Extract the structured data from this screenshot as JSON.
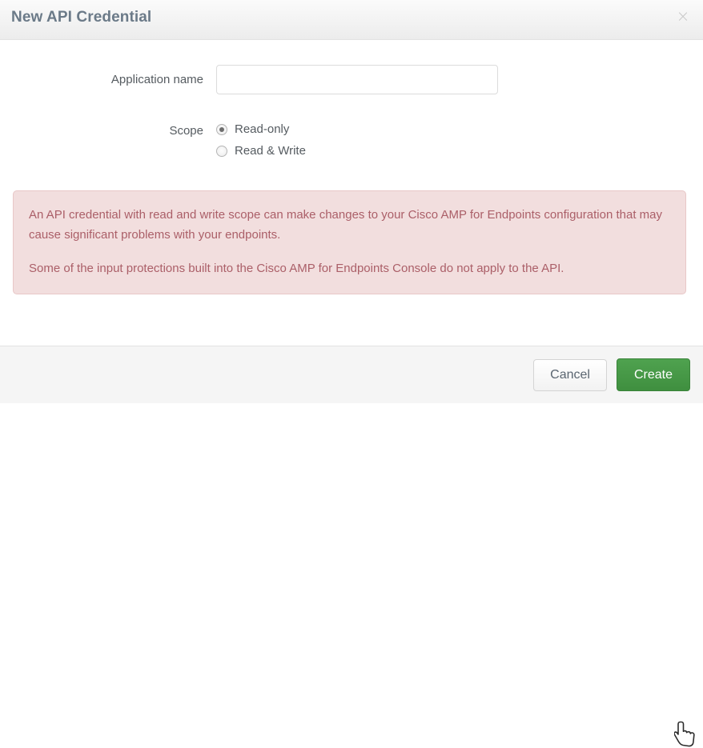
{
  "dialog": {
    "title": "New API Credential",
    "close_icon": "close-icon"
  },
  "form": {
    "application_name": {
      "label": "Application name",
      "value": "",
      "placeholder": ""
    },
    "scope": {
      "label": "Scope",
      "selected": "Read-only",
      "options": [
        {
          "label": "Read-only",
          "checked": true
        },
        {
          "label": "Read & Write",
          "checked": false
        }
      ]
    }
  },
  "warning": {
    "paragraphs": [
      "An API credential with read and write scope can make changes to your Cisco AMP for Endpoints configuration that may cause significant problems with your endpoints.",
      "Some of the input protections built into the Cisco AMP for Endpoints Console do not apply to the API."
    ]
  },
  "footer": {
    "cancel_label": "Cancel",
    "create_label": "Create"
  },
  "colors": {
    "header_bg": "#ececec",
    "title_text": "#6b7a88",
    "warning_bg": "#f2dede",
    "warning_border": "#e8c7c7",
    "warning_text": "#ab5f68",
    "create_button": "#3f8f3f",
    "footer_bg": "#f5f5f5"
  }
}
